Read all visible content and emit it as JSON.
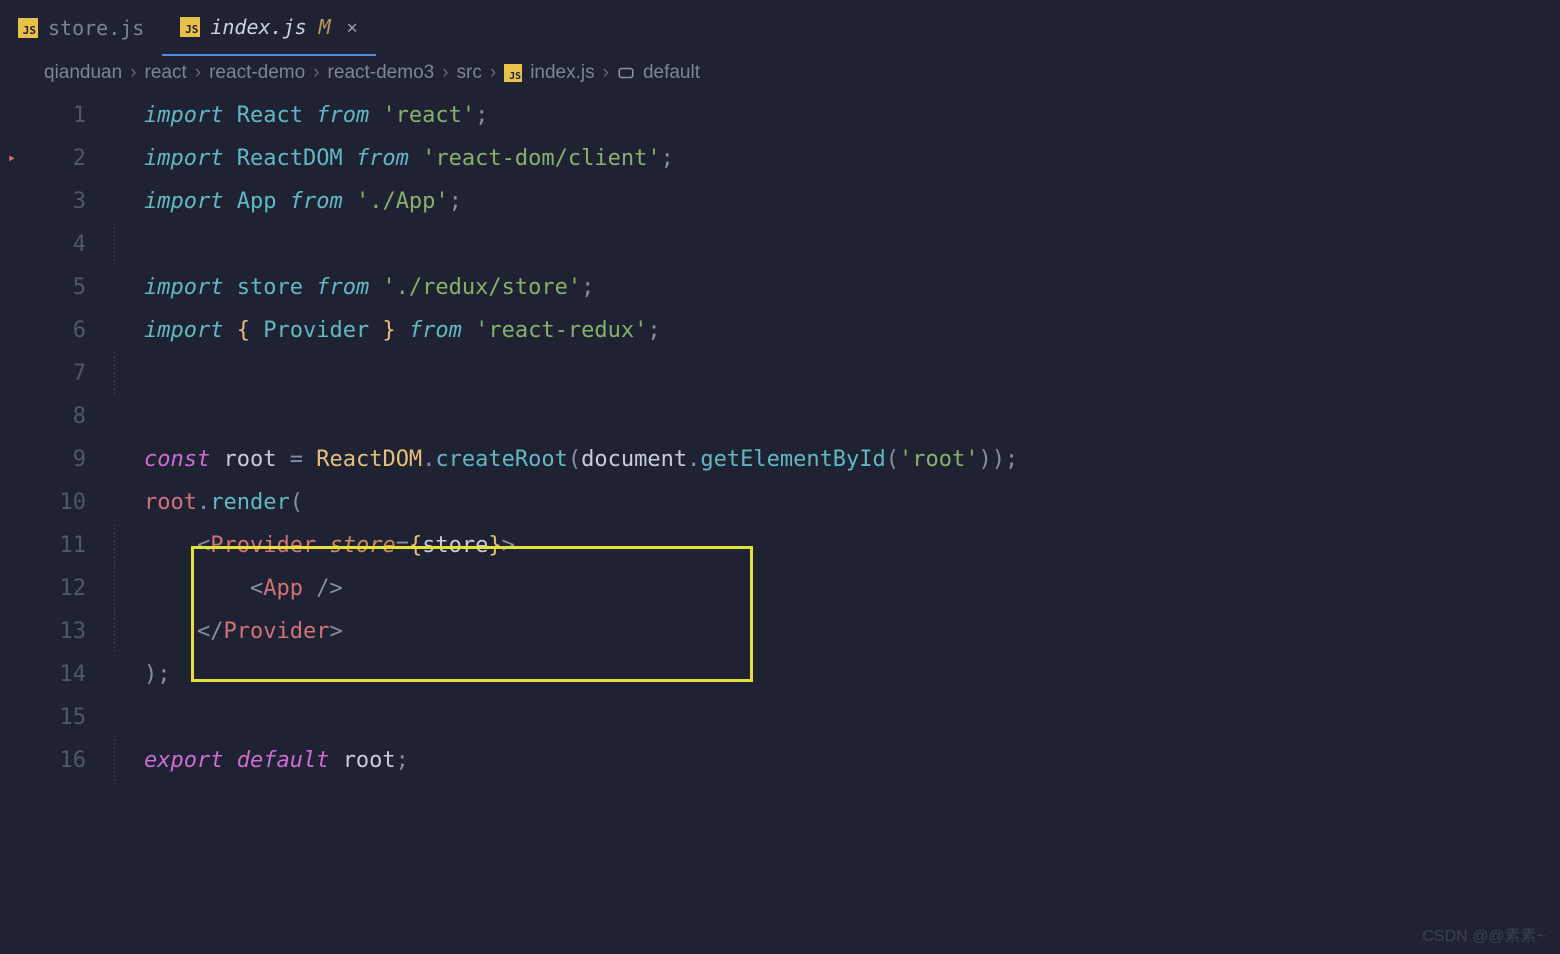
{
  "tabs": [
    {
      "label": "store.js",
      "active": false,
      "modified": false
    },
    {
      "label": "index.js",
      "active": true,
      "modified": true
    }
  ],
  "tab_modified_flag": "M",
  "js_icon_text": "JS",
  "close_glyph": "✕",
  "breadcrumbs": {
    "parts": [
      "qianduan",
      "react",
      "react-demo",
      "react-demo3",
      "src"
    ],
    "file": "index.js",
    "symbol": "default",
    "sep": "›"
  },
  "code_lines": [
    {
      "n": 1,
      "ind": false,
      "tokens": [
        [
          "kw-import",
          "import "
        ],
        [
          "ident-mod",
          "React"
        ],
        [
          "ident",
          " "
        ],
        [
          "kw-import",
          "from"
        ],
        [
          "ident",
          " "
        ],
        [
          "str",
          "'react'"
        ],
        [
          "punct",
          ";"
        ]
      ]
    },
    {
      "n": 2,
      "ind": false,
      "tokens": [
        [
          "kw-import",
          "import "
        ],
        [
          "ident-mod",
          "ReactDOM"
        ],
        [
          "ident",
          " "
        ],
        [
          "kw-import",
          "from"
        ],
        [
          "ident",
          " "
        ],
        [
          "str",
          "'react-dom/client'"
        ],
        [
          "punct",
          ";"
        ]
      ],
      "indicator": "▸"
    },
    {
      "n": 3,
      "ind": false,
      "tokens": [
        [
          "kw-import",
          "import "
        ],
        [
          "ident-mod",
          "App"
        ],
        [
          "ident",
          " "
        ],
        [
          "kw-import",
          "from"
        ],
        [
          "ident",
          " "
        ],
        [
          "str",
          "'./App'"
        ],
        [
          "punct",
          ";"
        ]
      ]
    },
    {
      "n": 4,
      "ind": true,
      "tokens": []
    },
    {
      "n": 5,
      "ind": false,
      "tokens": [
        [
          "kw-import",
          "import "
        ],
        [
          "ident-mod",
          "store"
        ],
        [
          "ident",
          " "
        ],
        [
          "kw-import",
          "from"
        ],
        [
          "ident",
          " "
        ],
        [
          "str",
          "'./redux/store'"
        ],
        [
          "punct",
          ";"
        ]
      ]
    },
    {
      "n": 6,
      "ind": false,
      "tokens": [
        [
          "kw-import",
          "import "
        ],
        [
          "brace",
          "{ "
        ],
        [
          "ident-mod",
          "Provider"
        ],
        [
          "brace",
          " }"
        ],
        [
          "ident",
          " "
        ],
        [
          "kw-import",
          "from"
        ],
        [
          "ident",
          " "
        ],
        [
          "str",
          "'react-redux'"
        ],
        [
          "punct",
          ";"
        ]
      ]
    },
    {
      "n": 7,
      "ind": true,
      "tokens": []
    },
    {
      "n": 8,
      "ind": false,
      "tokens": []
    },
    {
      "n": 9,
      "ind": false,
      "tokens": [
        [
          "kw-const",
          "const "
        ],
        [
          "ident",
          "root "
        ],
        [
          "punct",
          "= "
        ],
        [
          "ident-cls",
          "ReactDOM"
        ],
        [
          "punct",
          "."
        ],
        [
          "method",
          "createRoot"
        ],
        [
          "punct",
          "("
        ],
        [
          "propchain",
          "document"
        ],
        [
          "punct",
          "."
        ],
        [
          "method",
          "getElementById"
        ],
        [
          "punct",
          "("
        ],
        [
          "str",
          "'root'"
        ],
        [
          "punct",
          "));"
        ]
      ]
    },
    {
      "n": 10,
      "ind": false,
      "tokens": [
        [
          "obj",
          "root"
        ],
        [
          "punct",
          "."
        ],
        [
          "method",
          "render"
        ],
        [
          "punct",
          "("
        ]
      ]
    },
    {
      "n": 11,
      "ind": true,
      "tokens": [
        [
          "ident",
          "    "
        ],
        [
          "tag-punct",
          "<"
        ],
        [
          "tag-name",
          "Provider"
        ],
        [
          "ident",
          " "
        ],
        [
          "attr",
          "store"
        ],
        [
          "punct",
          "="
        ],
        [
          "brace",
          "{"
        ],
        [
          "ident",
          "store"
        ],
        [
          "brace",
          "}"
        ],
        [
          "tag-punct",
          ">"
        ]
      ]
    },
    {
      "n": 12,
      "ind": true,
      "tokens": [
        [
          "ident",
          "        "
        ],
        [
          "tag-punct",
          "<"
        ],
        [
          "tag-name",
          "App"
        ],
        [
          "ident",
          " "
        ],
        [
          "tag-punct",
          "/>"
        ]
      ]
    },
    {
      "n": 13,
      "ind": true,
      "tokens": [
        [
          "ident",
          "    "
        ],
        [
          "tag-punct",
          "</"
        ],
        [
          "tag-name",
          "Provider"
        ],
        [
          "tag-punct",
          ">"
        ]
      ]
    },
    {
      "n": 14,
      "ind": false,
      "tokens": [
        [
          "punct",
          ");"
        ]
      ]
    },
    {
      "n": 15,
      "ind": false,
      "tokens": []
    },
    {
      "n": 16,
      "ind": true,
      "tokens": [
        [
          "kw-export",
          "export default "
        ],
        [
          "ident",
          "root"
        ],
        [
          "punct",
          ";"
        ]
      ]
    }
  ],
  "watermark": "CSDN @@素素~"
}
